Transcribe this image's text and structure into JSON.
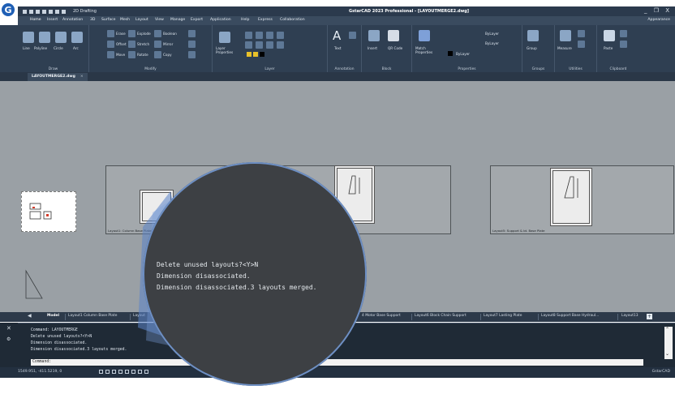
{
  "app": {
    "logo_letter": "G",
    "workspace": "2D Drafting",
    "title": "GstarCAD 2023 Professional - [LAYOUTMERGE2.dwg]",
    "window_controls": "_ ❐ X"
  },
  "menu": {
    "tabs": [
      "Home",
      "Insert",
      "Annotation",
      "3D",
      "Surface",
      "Mesh",
      "Layout",
      "View",
      "Manage",
      "Export",
      "Application",
      "Help",
      "Express",
      "Collaboration"
    ],
    "right": "Appearance"
  },
  "ribbon": {
    "draw": {
      "title": "Draw",
      "tools": [
        "Line",
        "Polyline",
        "Circle",
        "Arc"
      ]
    },
    "modify": {
      "title": "Modify",
      "tools": [
        "Erase",
        "Explode",
        "Boolean",
        "Offset",
        "Stretch",
        "Mirror",
        "Move",
        "Rotate",
        "Copy"
      ]
    },
    "layer": {
      "title": "Layer",
      "properties": "Layer Properties"
    },
    "annotation": {
      "title": "Annotation",
      "text": "Text"
    },
    "block": {
      "title": "Block",
      "insert": "Insert",
      "qrcode": "QR Code"
    },
    "properties": {
      "title": "Properties",
      "match": "Match Properties",
      "bylayer1": "ByLayer",
      "bylayer2": "ByLayer",
      "bylayer3": "ByLayer"
    },
    "groups": {
      "title": "Groups",
      "group": "Group"
    },
    "utilities": {
      "title": "Utilities",
      "measure": "Measure"
    },
    "clipboard": {
      "title": "Clipboard",
      "paste": "Paste"
    }
  },
  "doc_tab": {
    "label": "LAYOUTMERGE2.dwg",
    "close": "×"
  },
  "canvas": {
    "sheet_labels": [
      "Layout1: Column Base Plate",
      "Layout5: Support & bt. Base Plate"
    ]
  },
  "layout_tabs": {
    "model": "Model",
    "items": [
      "Layout1 Column Base Plate",
      "Layout",
      "4 Motor Base Support",
      "Layout6 Block Chain Support",
      "Layout7 Lasting Plate",
      "Layout8 Support Base Hydraul...",
      "Layout13"
    ],
    "add": "+"
  },
  "command": {
    "lines": [
      "Command: LAYOUTMERGE",
      "Delete unused layouts?<Y>N",
      "Dimension disassociated.",
      "Dimension disassociated.3 layouts merged."
    ],
    "prompt": "Command:"
  },
  "status": {
    "coords": "1549.951, -411.5219, 0",
    "right": "GstarCAD"
  },
  "magnifier": {
    "lines": [
      "Delete unused layouts?<Y>N",
      "Dimension disassociated.",
      "Dimension disassociated.3 layouts merged."
    ]
  },
  "colors": {
    "ribbon": "#2f3f52",
    "canvas": "#9aa0a5",
    "command_bg": "#1f2a36",
    "magnifier_bg": "#3d4044",
    "accent_blue": "#6d8fc4"
  }
}
